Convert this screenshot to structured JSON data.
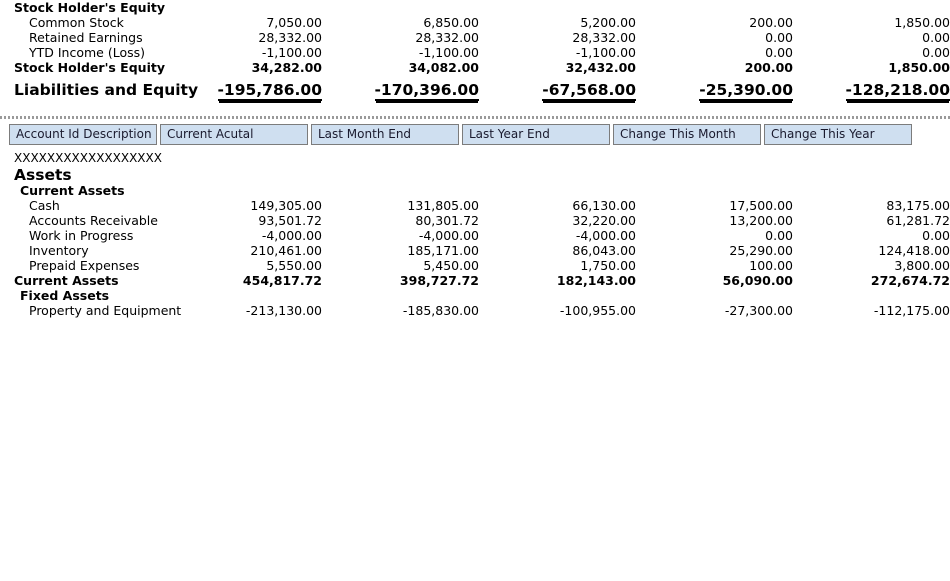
{
  "theme": {
    "header_bg": "#cfdff0",
    "header_border": "#7c7c7c",
    "divider": "#9a9a9a",
    "text": "#000000"
  },
  "top_section": {
    "rows": [
      {
        "label": "Stock Holder's Equity",
        "style": "group",
        "indent": 0,
        "values": [
          "",
          "",
          "",
          "",
          ""
        ]
      },
      {
        "label": "Common Stock",
        "style": "item",
        "indent": 2,
        "values": [
          "7,050.00",
          "6,850.00",
          "5,200.00",
          "200.00",
          "1,850.00"
        ]
      },
      {
        "label": "Retained Earnings",
        "style": "item",
        "indent": 2,
        "values": [
          "28,332.00",
          "28,332.00",
          "28,332.00",
          "0.00",
          "0.00"
        ]
      },
      {
        "label": "YTD Income (Loss)",
        "style": "item",
        "indent": 2,
        "values": [
          "-1,100.00",
          "-1,100.00",
          "-1,100.00",
          "0.00",
          "0.00"
        ]
      },
      {
        "label": "Stock Holder's Equity",
        "style": "group",
        "indent": 0,
        "values": [
          "34,282.00",
          "34,082.00",
          "32,432.00",
          "200.00",
          "1,850.00"
        ]
      },
      {
        "label": "Liabilities and Equity",
        "style": "total",
        "indent": 0,
        "values": [
          "-195,786.00",
          "-170,396.00",
          "-67,568.00",
          "-25,390.00",
          "-128,218.00"
        ]
      }
    ]
  },
  "column_header": {
    "columns": [
      "Account Id Description",
      "Current Acutal",
      "Last Month End",
      "Last Year End",
      "Change This Month",
      "Change This Year"
    ]
  },
  "bottom_section": {
    "placeholder": "XXXXXXXXXXXXXXXXXX",
    "rows": [
      {
        "label": "Assets",
        "style": "head",
        "indent": 0,
        "values": [
          "",
          "",
          "",
          "",
          ""
        ]
      },
      {
        "label": "Current Assets",
        "style": "group",
        "indent": 1,
        "values": [
          "",
          "",
          "",
          "",
          ""
        ]
      },
      {
        "label": "Cash",
        "style": "item",
        "indent": 2,
        "values": [
          "149,305.00",
          "131,805.00",
          "66,130.00",
          "17,500.00",
          "83,175.00"
        ]
      },
      {
        "label": "Accounts Receivable",
        "style": "item",
        "indent": 2,
        "values": [
          "93,501.72",
          "80,301.72",
          "32,220.00",
          "13,200.00",
          "61,281.72"
        ]
      },
      {
        "label": "Work in Progress",
        "style": "item",
        "indent": 2,
        "values": [
          "-4,000.00",
          "-4,000.00",
          "-4,000.00",
          "0.00",
          "0.00"
        ]
      },
      {
        "label": "Inventory",
        "style": "item",
        "indent": 2,
        "values": [
          "210,461.00",
          "185,171.00",
          "86,043.00",
          "25,290.00",
          "124,418.00"
        ]
      },
      {
        "label": "Prepaid Expenses",
        "style": "item",
        "indent": 2,
        "values": [
          "5,550.00",
          "5,450.00",
          "1,750.00",
          "100.00",
          "3,800.00"
        ]
      },
      {
        "label": "Current Assets",
        "style": "group",
        "indent": 0,
        "values": [
          "454,817.72",
          "398,727.72",
          "182,143.00",
          "56,090.00",
          "272,674.72"
        ]
      },
      {
        "label": "Fixed Assets",
        "style": "group",
        "indent": 1,
        "values": [
          "",
          "",
          "",
          "",
          ""
        ]
      },
      {
        "label": "Property and Equipment",
        "style": "item",
        "indent": 2,
        "values": [
          "-213,130.00",
          "-185,830.00",
          "-100,955.00",
          "-27,300.00",
          "-112,175.00"
        ]
      }
    ]
  }
}
